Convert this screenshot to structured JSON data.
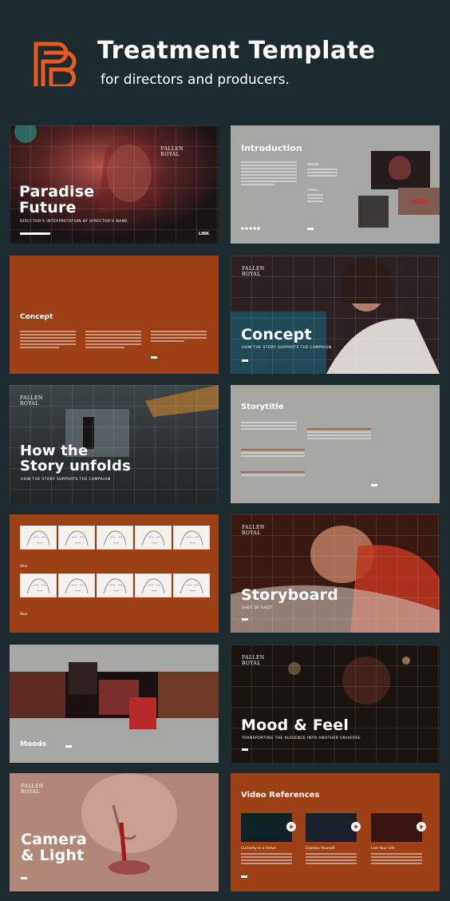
{
  "header": {
    "title": "Treatment Template",
    "subtitle": "for directors and producers."
  },
  "colors": {
    "background": "#1d2b2e",
    "accent": "#e85a24",
    "rust": "#9e4015",
    "grey": "#a6a6a3"
  },
  "slides": {
    "s1": {
      "title1": "Paradise",
      "title2": "Future",
      "caption": "DIRECTOR'S INTERPRETATION BY DIRECTOR'S NAME",
      "brand1": "FALLEN",
      "brand2": "ROYAL",
      "footer_right": "LINK"
    },
    "s2": {
      "title": "Introduction",
      "side1": "Awards",
      "side2": "Clients"
    },
    "s3": {
      "title": "Concept"
    },
    "s4": {
      "title": "Concept",
      "caption": "HOW THE STORY SUPPORTS THE CAMPAIGN",
      "brand1": "FALLEN",
      "brand2": "ROYAL"
    },
    "s5": {
      "title1": "How the",
      "title2": "Story unfolds",
      "caption": "HOW THE STORY SUPPORTS THE CAMPAIGN",
      "brand1": "FALLEN",
      "brand2": "ROYAL"
    },
    "s6": {
      "title": "Storytitle"
    },
    "s7": {
      "label": "Shot"
    },
    "s8": {
      "title": "Storyboard",
      "caption": "SHOT BY SHOT",
      "brand1": "FALLEN",
      "brand2": "ROYAL"
    },
    "s9": {
      "title": "Moods"
    },
    "s10": {
      "title": "Mood & Feel",
      "caption": "TRANSPORTING THE AUDIENCE INTO ANOTHER UNIVERSE",
      "brand1": "FALLEN",
      "brand2": "ROYAL"
    },
    "s11": {
      "title1": "Camera",
      "title2": "& Light",
      "brand1": "FALLEN",
      "brand2": "ROYAL"
    },
    "s12": {
      "title": "Video References",
      "v1": "Curiosity Is a Virtue",
      "v2": "Express Yourself",
      "v3": "Live Your Life"
    }
  }
}
